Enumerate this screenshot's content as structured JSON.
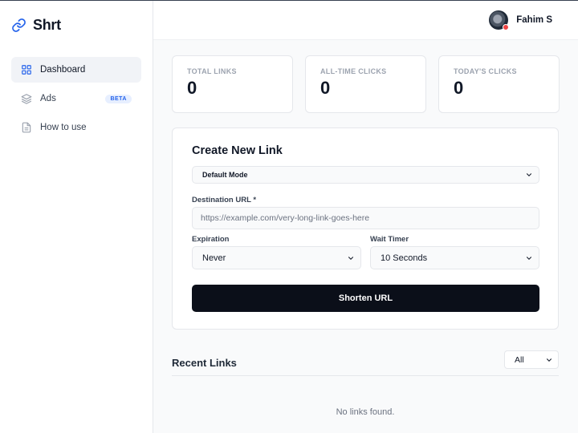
{
  "brand": {
    "name": "Shrt",
    "icon": "link-icon"
  },
  "sidebar": {
    "items": [
      {
        "label": "Dashboard",
        "icon": "grid-icon",
        "active": true
      },
      {
        "label": "Ads",
        "icon": "layers-icon",
        "badge": "BETA"
      },
      {
        "label": "How to use",
        "icon": "document-icon"
      }
    ]
  },
  "header": {
    "user_name": "Fahim S",
    "status_color": "#ef4444"
  },
  "stats": [
    {
      "label": "TOTAL LINKS",
      "value": "0"
    },
    {
      "label": "ALL-TIME CLICKS",
      "value": "0"
    },
    {
      "label": "TODAY'S CLICKS",
      "value": "0"
    }
  ],
  "create_link": {
    "title": "Create New Link",
    "mode": "Default Mode",
    "destination_label": "Destination URL *",
    "destination_placeholder": "https://example.com/very-long-link-goes-here",
    "destination_value": "",
    "expiration_label": "Expiration",
    "expiration_value": "Never",
    "wait_timer_label": "Wait Timer",
    "wait_timer_value": "10 Seconds",
    "submit_label": "Shorten URL"
  },
  "recent_links": {
    "title": "Recent Links",
    "filter": "All",
    "empty_message": "No links found."
  },
  "colors": {
    "accent": "#2563eb",
    "button": "#0b0f19",
    "background": "#f9fafb"
  }
}
